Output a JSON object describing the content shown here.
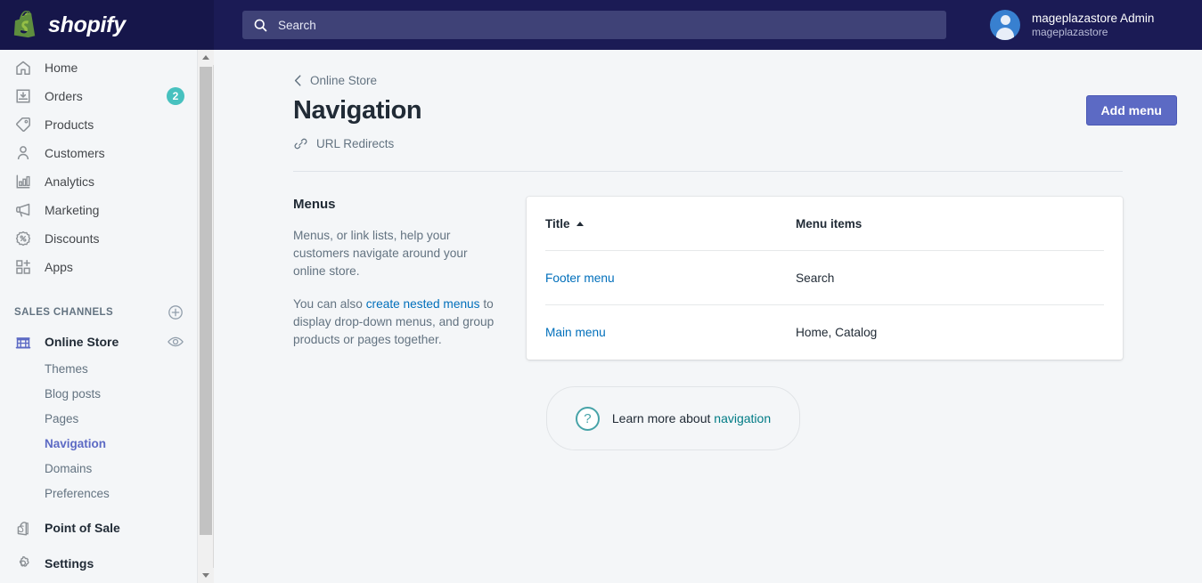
{
  "topbar": {
    "brand_name": "shopify",
    "brand_logo_icon": "shopify-bag-logo",
    "search": {
      "icon": "search-icon",
      "placeholder": "Search",
      "value": ""
    },
    "user": {
      "avatar_icon": "user-avatar",
      "name": "mageplazastore Admin",
      "store": "mageplazastore"
    },
    "colors": {
      "bar_background": "#1b1b55",
      "brand_background": "#16164a",
      "search_background": "#3f4277"
    }
  },
  "sidebar": {
    "items": [
      {
        "label": "Home",
        "icon": "home-icon",
        "badge": ""
      },
      {
        "label": "Orders",
        "icon": "orders-icon",
        "badge": "2"
      },
      {
        "label": "Products",
        "icon": "tag-icon",
        "badge": ""
      },
      {
        "label": "Customers",
        "icon": "person-icon",
        "badge": ""
      },
      {
        "label": "Analytics",
        "icon": "bar-chart-icon",
        "badge": ""
      },
      {
        "label": "Marketing",
        "icon": "megaphone-icon",
        "badge": ""
      },
      {
        "label": "Discounts",
        "icon": "discount-icon",
        "badge": ""
      },
      {
        "label": "Apps",
        "icon": "apps-plus-icon",
        "badge": ""
      }
    ],
    "sales_channels": {
      "title": "SALES CHANNELS",
      "add_icon": "plus-circle-icon",
      "online_store": {
        "label": "Online Store",
        "icon": "storefront-icon",
        "view_icon": "eye-icon"
      },
      "sub_items": [
        {
          "label": "Themes",
          "active": false
        },
        {
          "label": "Blog posts",
          "active": false
        },
        {
          "label": "Pages",
          "active": false
        },
        {
          "label": "Navigation",
          "active": true
        },
        {
          "label": "Domains",
          "active": false
        },
        {
          "label": "Preferences",
          "active": false
        }
      ]
    },
    "point_of_sale": {
      "label": "Point of Sale",
      "icon": "shopify-pos-icon"
    },
    "settings": {
      "label": "Settings",
      "icon": "gear-icon"
    },
    "scrollbar": {
      "up_icon": "scroll-up-arrow",
      "down_icon": "scroll-down-arrow"
    },
    "badge_color": "#47c1bf",
    "active_color": "#5c6ac4"
  },
  "main": {
    "breadcrumb": {
      "back_icon": "chevron-left-icon",
      "label": "Online Store"
    },
    "page_title": "Navigation",
    "add_menu_button": "Add menu",
    "url_redirects": {
      "icon": "link-icon",
      "label": "URL Redirects"
    },
    "menus_panel": {
      "heading": "Menus",
      "paragraph_1": "Menus, or link lists, help your customers navigate around your online store.",
      "paragraph_2_before": "You can also ",
      "paragraph_2_link": "create nested menus",
      "paragraph_2_after": " to display drop-down menus, and group products or pages together."
    },
    "table": {
      "columns": [
        "Title",
        "Menu items"
      ],
      "sort_column": "Title",
      "sort_direction": "ascending",
      "sort_icon": "sort-ascending-caret",
      "rows": [
        {
          "title": "Footer menu",
          "menu_items": "Search"
        },
        {
          "title": "Main menu",
          "menu_items": "Home, Catalog"
        }
      ]
    },
    "learn_more": {
      "icon": "question-mark-circle-icon",
      "text_before": "Learn more about ",
      "link": "navigation"
    }
  }
}
